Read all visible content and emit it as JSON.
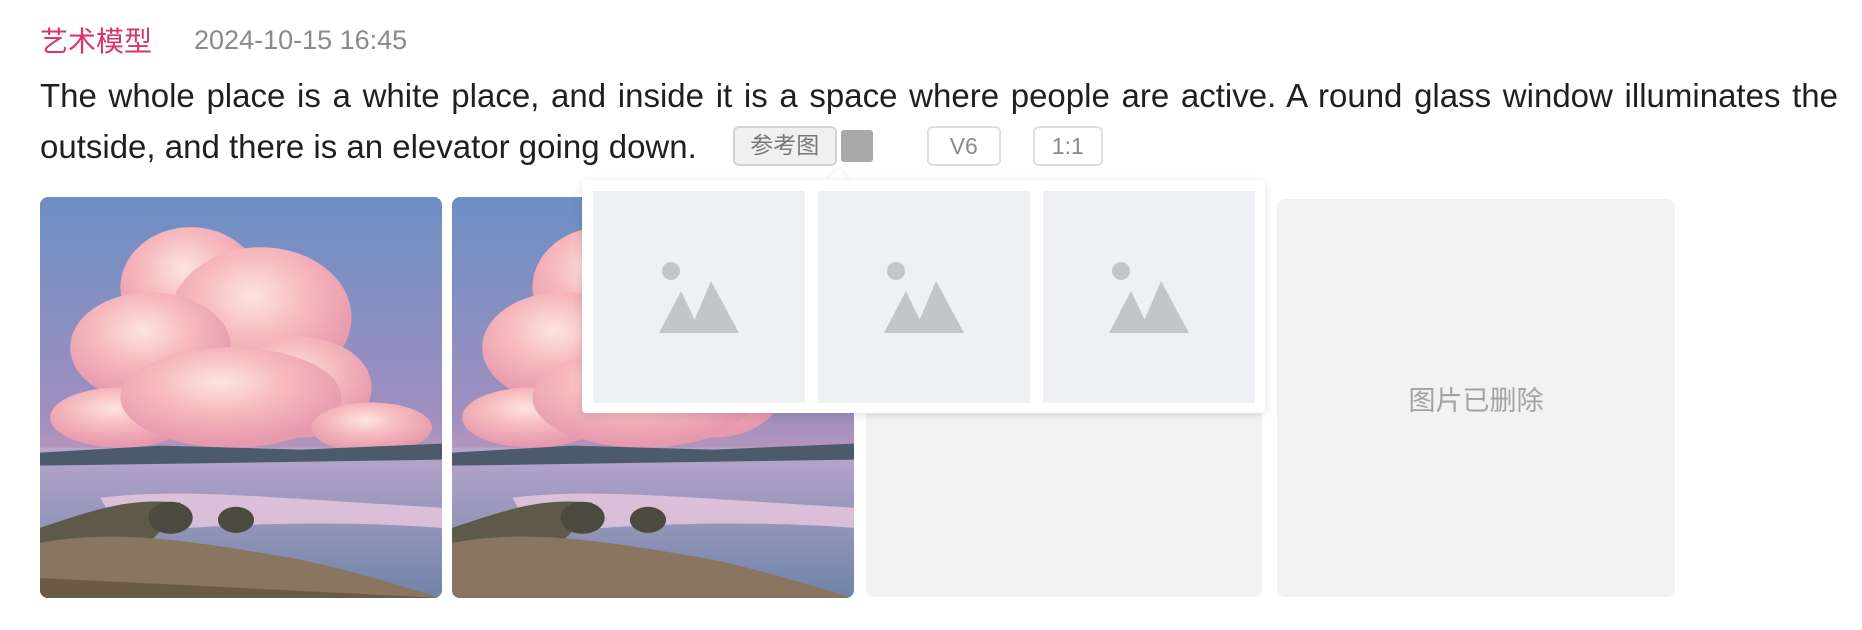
{
  "header": {
    "model_name": "艺术模型",
    "timestamp": "2024-10-15 16:45"
  },
  "prompt": {
    "text": "The whole place is a white place, and inside it is a space where people are active. A round glass window illuminates the outside, and there is an elevator going down.",
    "tags": {
      "reference": "参考图",
      "version": "V6",
      "ratio": "1:1"
    }
  },
  "images": {
    "deleted_label": "图片已删除"
  },
  "popover": {
    "placeholders": [
      "image-placeholder-icon",
      "image-placeholder-icon",
      "image-placeholder-icon"
    ]
  },
  "colors": {
    "model_name": "#d6366a",
    "timestamp": "#8a8a8a",
    "placeholder_bg": "#eff0f3",
    "placeholder_icon": "#c4c5c8",
    "deleted_bg": "#f2f2f2"
  }
}
